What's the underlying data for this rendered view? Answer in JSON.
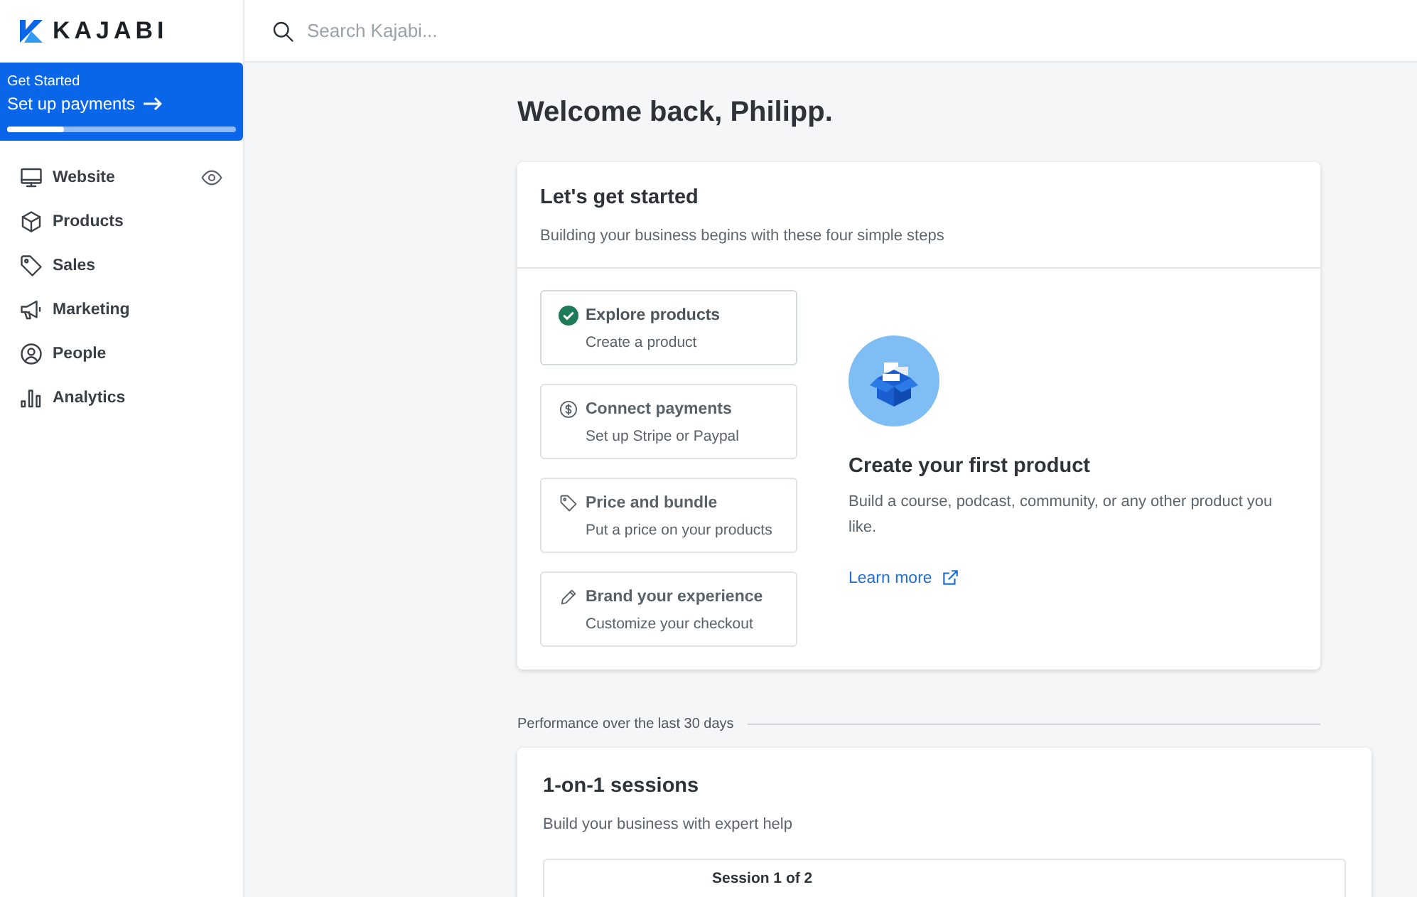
{
  "logo": {
    "text": "KAJABI"
  },
  "search": {
    "placeholder": "Search Kajabi..."
  },
  "get_started": {
    "label": "Get Started",
    "action": "Set up payments",
    "level": 0.25
  },
  "nav": [
    {
      "label": "Website",
      "kind": "monitor",
      "preview": true
    },
    {
      "label": "Products",
      "kind": "cube",
      "preview": false
    },
    {
      "label": "Sales",
      "kind": "tag",
      "preview": false
    },
    {
      "label": "Marketing",
      "kind": "megaphone",
      "preview": false
    },
    {
      "label": "People",
      "kind": "person",
      "preview": false
    },
    {
      "label": "Analytics",
      "kind": "bars",
      "preview": false
    }
  ],
  "greeting": "Welcome back, Philipp.",
  "start_card": {
    "title": "Let's get started",
    "subtitle": "Building your business begins with these four simple steps",
    "steps": [
      {
        "title": "Explore products",
        "subtitle": "Create a product",
        "kind": "check",
        "completed": true
      },
      {
        "title": "Connect payments",
        "subtitle": "Set up Stripe or Paypal",
        "kind": "dollar",
        "completed": false
      },
      {
        "title": "Price and bundle",
        "subtitle": "Put a price on your products",
        "kind": "tag",
        "completed": false
      },
      {
        "title": "Brand your experience",
        "subtitle": "Customize your checkout",
        "kind": "pencil",
        "completed": false
      }
    ],
    "detail": {
      "title": "Create your first product",
      "text": "Build a course, podcast, community, or any other product you like.",
      "link": "Learn more"
    }
  },
  "performance_label": "Performance over the last 30 days",
  "sessions_card": {
    "title": "1-on-1 sessions",
    "subtitle": "Build your business with expert help",
    "session": "Session 1 of 2"
  }
}
